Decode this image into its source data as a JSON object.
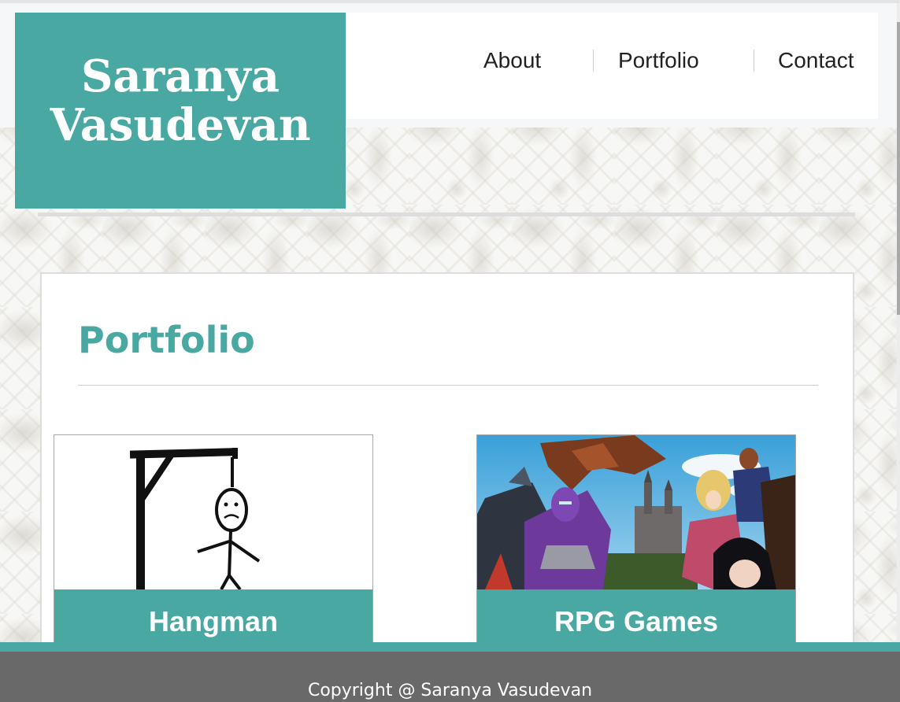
{
  "header": {
    "name_line1": "Saranya",
    "name_line2": "Vasudevan"
  },
  "nav": {
    "items": [
      {
        "label": "About"
      },
      {
        "label": "Portfolio"
      },
      {
        "label": "Contact"
      }
    ]
  },
  "main": {
    "title": "Portfolio",
    "projects": [
      {
        "label": "Hangman",
        "image": "hangman-drawing"
      },
      {
        "label": "RPG Games",
        "image": "rpg-games-collage"
      }
    ]
  },
  "footer": {
    "copyright": "Copyright @ Saranya Vasudevan"
  },
  "colors": {
    "accent": "#4aa8a2",
    "footer_bg": "#696969",
    "text_dark": "#222222"
  }
}
